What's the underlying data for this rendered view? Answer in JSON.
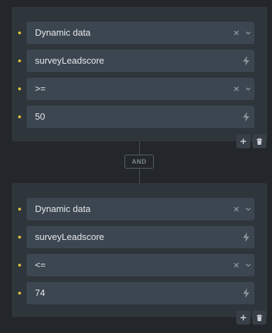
{
  "conditions": [
    {
      "rows": [
        {
          "value": "Dynamic data",
          "control": "select"
        },
        {
          "value": "surveyLeadscore",
          "control": "dynamic"
        },
        {
          "value": ">=",
          "control": "select"
        },
        {
          "value": "50",
          "control": "dynamic"
        }
      ]
    },
    {
      "rows": [
        {
          "value": "Dynamic data",
          "control": "select"
        },
        {
          "value": "surveyLeadscore",
          "control": "dynamic"
        },
        {
          "value": "<=",
          "control": "select"
        },
        {
          "value": "74",
          "control": "dynamic"
        }
      ]
    }
  ],
  "connector": {
    "label": "AND"
  },
  "icons": {
    "clear": "close-icon",
    "dropdown": "chevron-down-icon",
    "dynamic_data": "bolt-icon",
    "add": "plus-icon",
    "delete": "trash-icon"
  },
  "colors": {
    "background": "#23272b",
    "panel": "#2e353b",
    "field": "#3c4650",
    "bullet": "#e1c23b",
    "text": "#e6e9ec",
    "muted": "#7d868f"
  }
}
